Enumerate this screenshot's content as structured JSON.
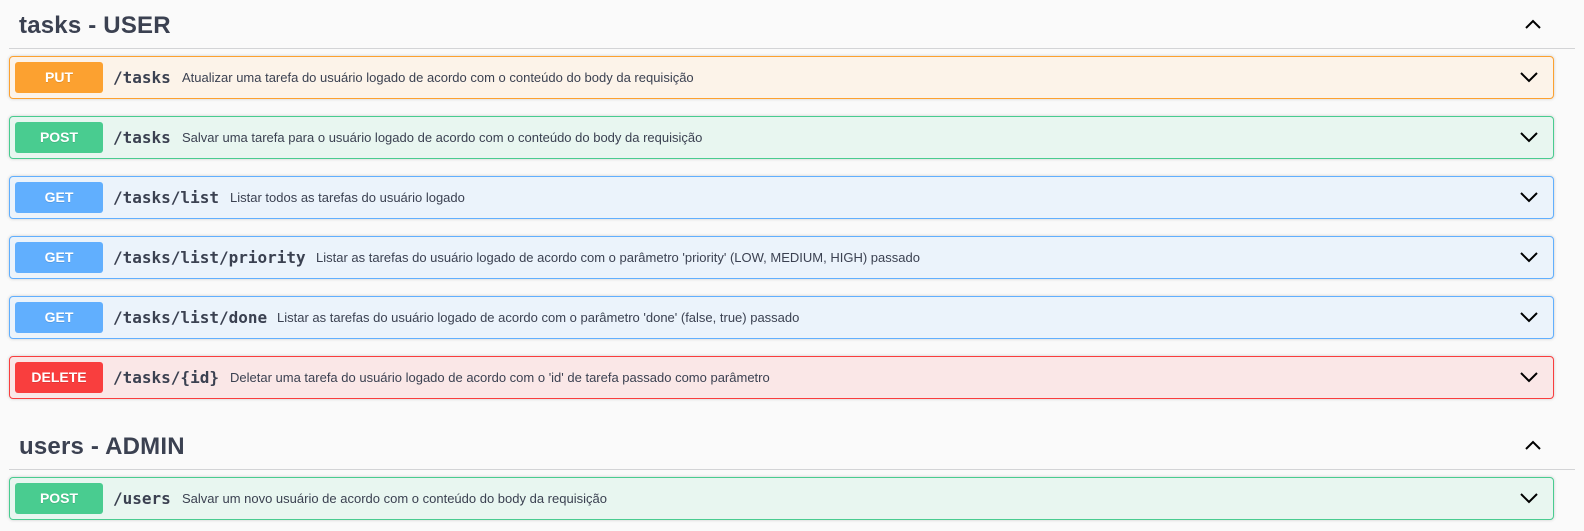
{
  "sections": [
    {
      "title": "tasks - USER",
      "operations": [
        {
          "method": "PUT",
          "path": "/tasks",
          "description": "Atualizar uma tarefa do usuário logado de acordo com o conteúdo do body da requisição"
        },
        {
          "method": "POST",
          "path": "/tasks",
          "description": "Salvar uma tarefa para o usuário logado de acordo com o conteúdo do body da requisição"
        },
        {
          "method": "GET",
          "path": "/tasks/list",
          "description": "Listar todos as tarefas do usuário logado"
        },
        {
          "method": "GET",
          "path": "/tasks/list/priority",
          "description": "Listar as tarefas do usuário logado de acordo com o parâmetro 'priority' (LOW, MEDIUM, HIGH) passado"
        },
        {
          "method": "GET",
          "path": "/tasks/list/done",
          "description": "Listar as tarefas do usuário logado de acordo com o parâmetro 'done' (false, true) passado"
        },
        {
          "method": "DELETE",
          "path": "/tasks/{id}",
          "description": "Deletar uma tarefa do usuário logado de acordo com o 'id' de tarefa passado como parâmetro"
        }
      ]
    },
    {
      "title": "users - ADMIN",
      "operations": [
        {
          "method": "POST",
          "path": "/users",
          "description": "Salvar um novo usuário de acordo com o conteúdo do body da requisição"
        }
      ]
    }
  ],
  "icons": {
    "section_toggle": "chevron-up-icon",
    "operation_toggle": "chevron-down-icon"
  },
  "colors": {
    "put": "#fca130",
    "post": "#49cc90",
    "get": "#61affe",
    "delete": "#f93e3e"
  }
}
